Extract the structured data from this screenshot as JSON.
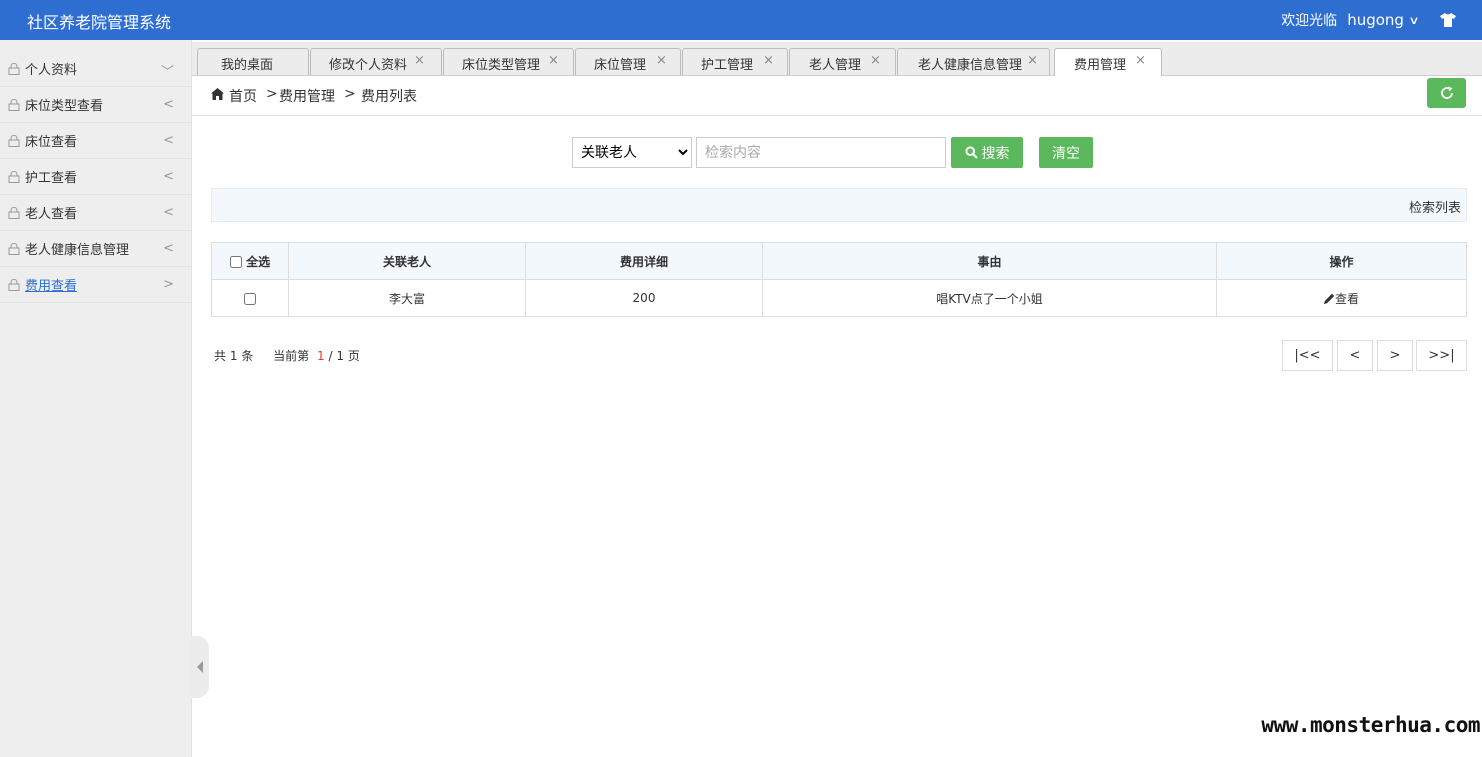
{
  "header": {
    "title": "社区养老院管理系统",
    "welcome": "欢迎光临",
    "username": "hugong",
    "dropdown_icon": "chevron-down-icon",
    "theme_icon": "shirt-icon",
    "bg_color": "#2e6ed0"
  },
  "sidebar": {
    "items": [
      {
        "label": "个人资料",
        "arrow": "﹀"
      },
      {
        "label": "床位类型查看",
        "arrow": "<"
      },
      {
        "label": "床位查看",
        "arrow": "<"
      },
      {
        "label": "护工查看",
        "arrow": "<"
      },
      {
        "label": "老人查看",
        "arrow": "<"
      },
      {
        "label": "老人健康信息管理",
        "arrow": "<"
      },
      {
        "label": "费用查看",
        "arrow": ">",
        "active": true
      }
    ]
  },
  "tabs": [
    {
      "label": "我的桌面",
      "closable": false
    },
    {
      "label": "修改个人资料",
      "closable": true
    },
    {
      "label": "床位类型管理",
      "closable": true
    },
    {
      "label": "床位管理",
      "closable": true
    },
    {
      "label": "护工管理",
      "closable": true
    },
    {
      "label": "老人管理",
      "closable": true
    },
    {
      "label": "老人健康信息管理",
      "closable": true
    },
    {
      "label": "费用管理",
      "closable": true,
      "active": true
    }
  ],
  "tab_close_glyph": "×",
  "breadcrumb": {
    "home": "首页",
    "sep": ">",
    "level1": "费用管理",
    "level2": "费用列表"
  },
  "search": {
    "select_value": "关联老人",
    "placeholder": "检索内容",
    "search_label": "搜索",
    "clear_label": "清空"
  },
  "panel": {
    "title": "检索列表"
  },
  "table": {
    "select_all": "全选",
    "columns": [
      "关联老人",
      "费用详细",
      "事由",
      "操作"
    ],
    "rows": [
      {
        "elder": "李大富",
        "amount": "200",
        "reason": "唱KTV点了一个小姐",
        "action": "查看"
      }
    ]
  },
  "pager": {
    "total_prefix": "共",
    "total": "1",
    "total_suffix": "条",
    "current_prefix": "当前第",
    "current": "1",
    "slash": "/",
    "pages": "1",
    "pages_suffix": "页",
    "first": "|<<",
    "prev": "<",
    "next": ">",
    "last": ">>|"
  },
  "watermark": "www.monsterhua.com",
  "colors": {
    "accent": "#2e6ed0",
    "green": "#5cb85c",
    "sidebar_bg": "#eeeeee"
  }
}
